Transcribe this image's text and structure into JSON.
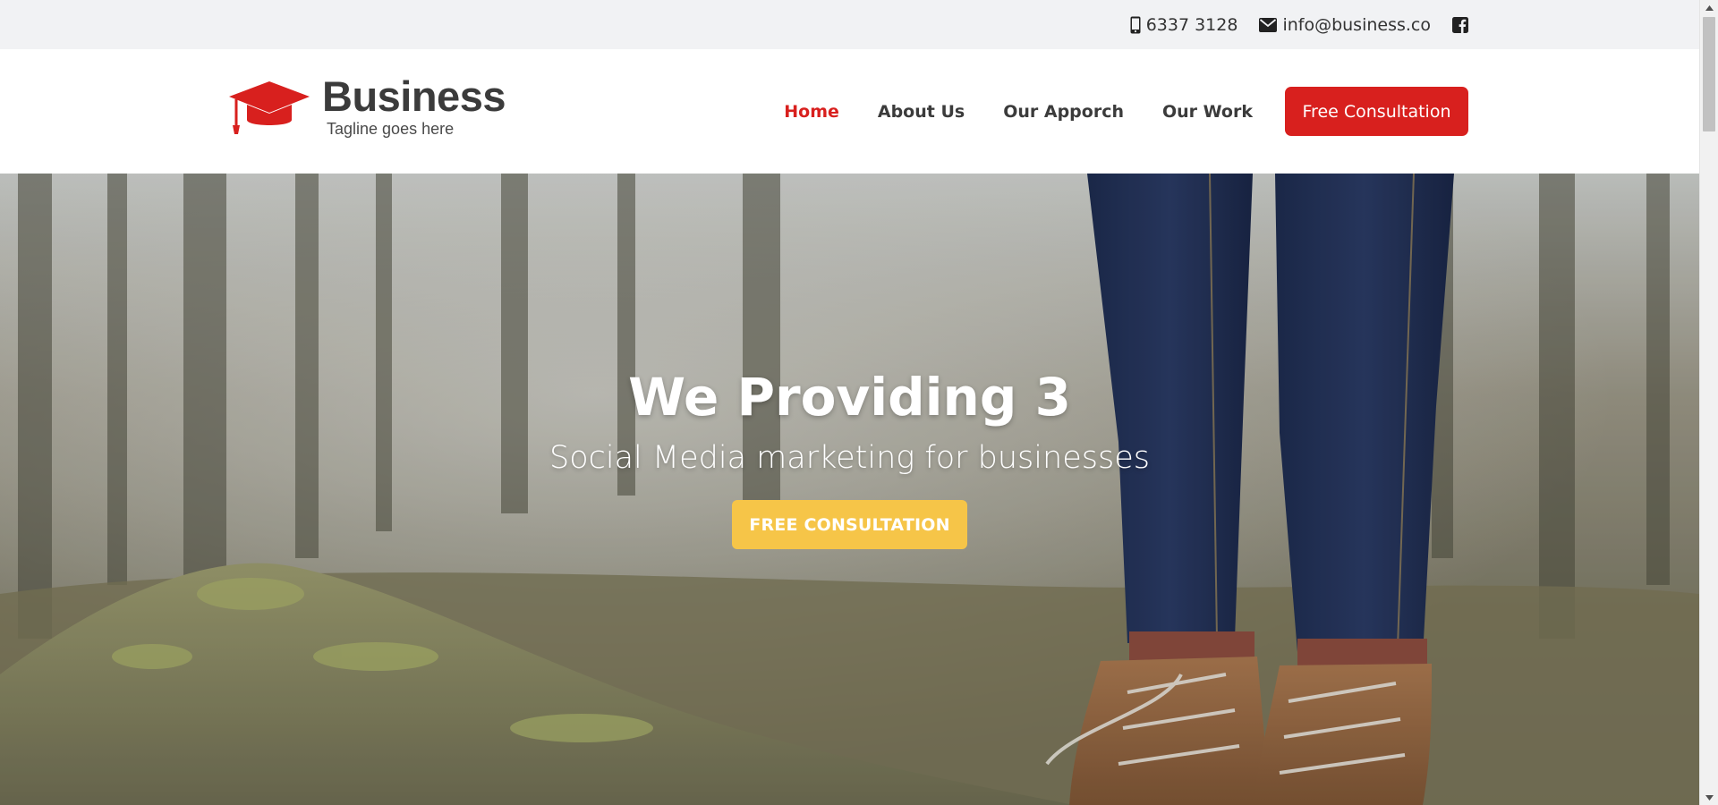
{
  "topbar": {
    "phone": "6337 3128",
    "email": "info@business.co",
    "icons": [
      "mobile-phone-icon",
      "envelope-icon",
      "facebook-icon"
    ]
  },
  "header": {
    "brand_name": "Business",
    "tagline": "Tagline goes here",
    "logo_icon": "graduation-cap-icon",
    "nav": [
      {
        "label": "Home",
        "active": true
      },
      {
        "label": "About Us",
        "active": false
      },
      {
        "label": "Our Apporch",
        "active": false
      },
      {
        "label": "Our Work",
        "active": false
      }
    ],
    "cta_label": "Free Consultation"
  },
  "hero": {
    "title": "We Providing 3",
    "subtitle": "Social Media marketing for businesses",
    "cta_label": "FREE CONSULTATION"
  },
  "colors": {
    "brand_red": "#d8201e",
    "hero_cta_yellow": "#f6c548",
    "topbar_bg": "#f1f2f4",
    "text_dark": "#3b3b3b"
  }
}
